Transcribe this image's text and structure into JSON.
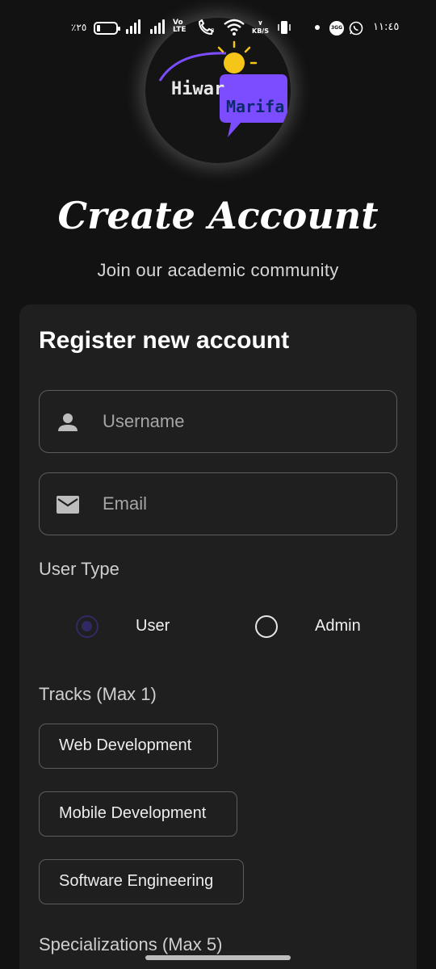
{
  "status_bar": {
    "battery_percent": "٪٢٥",
    "network_label_top": "Vo",
    "network_label_bottom": "LTE",
    "speed_value": "٧",
    "speed_unit": "KB/S",
    "app_badge": "3GG",
    "time": "١١:٤٥"
  },
  "logo": {
    "word_1": "Hiwar",
    "word_2": "Marifa"
  },
  "header": {
    "title": "Create Account",
    "subtitle": "Join our academic community"
  },
  "form": {
    "title": "Register new account",
    "username": {
      "placeholder": "Username",
      "value": ""
    },
    "email": {
      "placeholder": "Email",
      "value": ""
    },
    "user_type": {
      "label": "User Type",
      "options": [
        "User",
        "Admin"
      ],
      "selected": "User"
    },
    "tracks": {
      "label": "Tracks (Max 1)",
      "options": [
        "Web Development",
        "Mobile Development",
        "Software Engineering"
      ]
    },
    "specializations": {
      "label": "Specializations (Max 5)"
    }
  },
  "colors": {
    "background": "#121212",
    "card": "#1f1f1f",
    "radio_selected": "#2f2a63",
    "logo_bubble": "#7c4dff",
    "logo_sun": "#f5c518"
  },
  "icons": [
    "person-icon",
    "mail-icon"
  ]
}
